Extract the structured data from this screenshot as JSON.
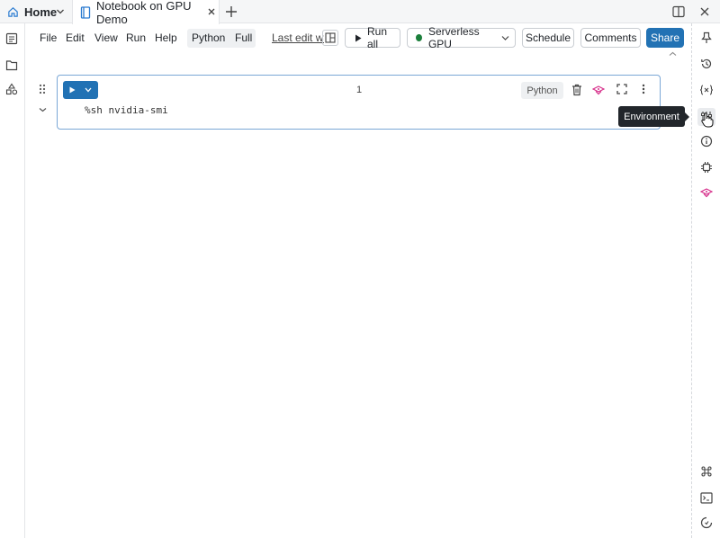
{
  "tabs": {
    "home_label": "Home",
    "active_label": "Notebook on GPU Demo"
  },
  "menu": {
    "items": [
      "File",
      "Edit",
      "View",
      "Run",
      "Help"
    ],
    "language": "Python",
    "mode": "Full",
    "last_edit": "Last edit wa"
  },
  "toolbar": {
    "run_all": "Run all",
    "compute": "Serverless GPU",
    "schedule": "Schedule",
    "comments": "Comments",
    "share": "Share"
  },
  "cell": {
    "number": "1",
    "language": "Python",
    "code": "%sh nvidia-smi"
  },
  "tooltip": "Environment",
  "colors": {
    "accent": "#2272b4",
    "compute_status": "#1b7f3b",
    "assistant": "#d62e8a"
  }
}
